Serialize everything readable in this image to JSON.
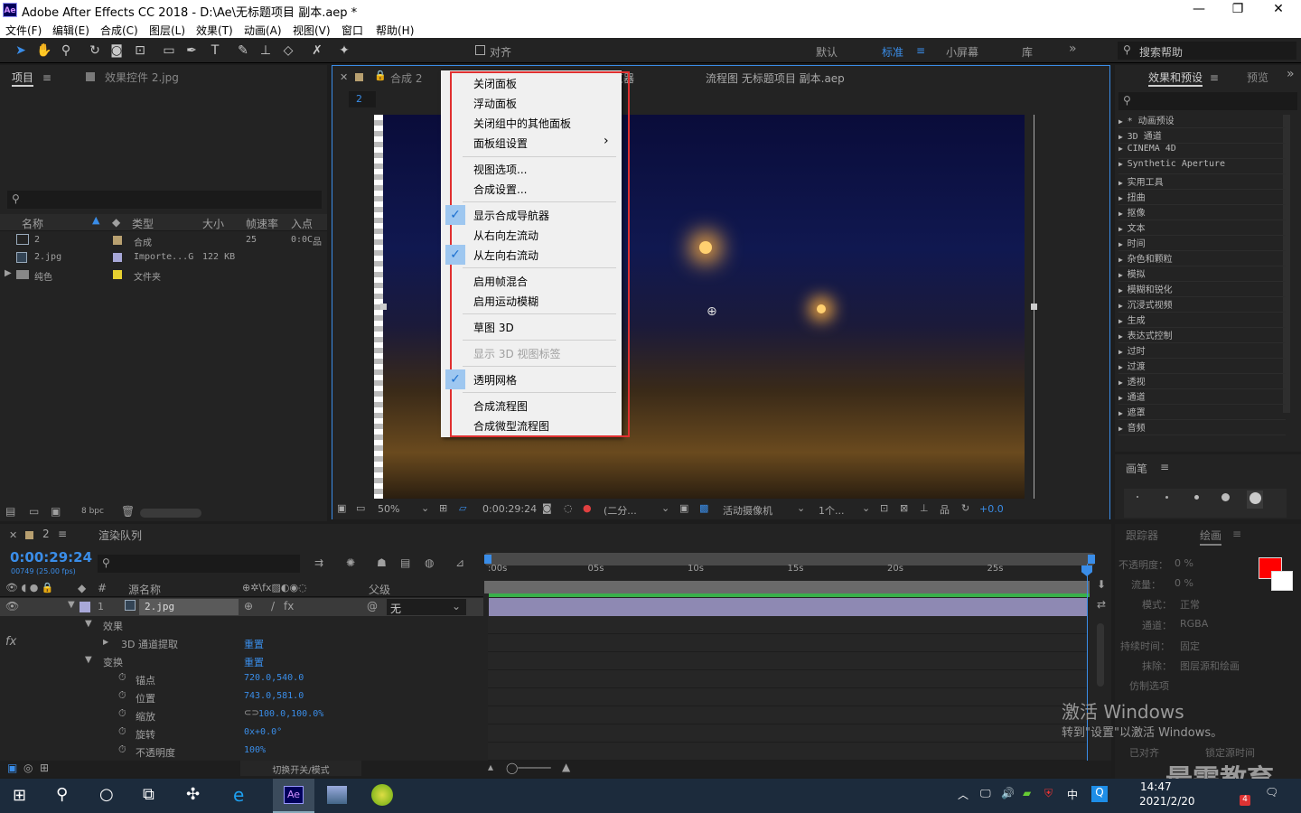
{
  "window": {
    "title": "Adobe After Effects CC 2018 - D:\\Ae\\无标题项目 副本.aep *",
    "app_badge": "Ae",
    "minimize": "—",
    "maximize": "❐",
    "close": "✕"
  },
  "menu": [
    "文件(F)",
    "编辑(E)",
    "合成(C)",
    "图层(L)",
    "效果(T)",
    "动画(A)",
    "视图(V)",
    "窗口",
    "帮助(H)"
  ],
  "toolbar": {
    "snap_label": "对齐",
    "workspaces": [
      "默认",
      "标准",
      "小屏幕",
      "库"
    ],
    "active_workspace": "标准",
    "search_placeholder": "搜索帮助",
    "more": "»"
  },
  "project_panel": {
    "tab": "项目",
    "effect_controls_tab": "效果控件 2.jpg",
    "columns": [
      "名称",
      "类型",
      "大小",
      "帧速率",
      "入点"
    ],
    "items": [
      {
        "name": "2",
        "type": "合成",
        "size": "",
        "fps": "25",
        "in": "0:0C",
        "color": "#b8a070"
      },
      {
        "name": "2.jpg",
        "type": "Importe...G",
        "size": "122 KB",
        "fps": "",
        "in": "",
        "color": "#a8a8d8"
      },
      {
        "name": "纯色",
        "type": "文件夹",
        "size": "",
        "fps": "",
        "in": "",
        "color": "#e6d030"
      }
    ],
    "bpc": "8 bpc"
  },
  "comp_panel": {
    "tab": "合成 2",
    "tab_num": "2",
    "viewer_tab": "览器",
    "flowchart_tab": "流程图 无标题项目 副本.aep",
    "zoom": "50%",
    "timecode": "0:00:29:24",
    "resolution": "(二分...",
    "camera": "活动摄像机",
    "views": "1个...",
    "exposure": "+0.0"
  },
  "context_menu": {
    "items": [
      {
        "label": "关闭面板",
        "checked": false,
        "disabled": false
      },
      {
        "label": "浮动面板",
        "checked": false,
        "disabled": false
      },
      {
        "label": "关闭组中的其他面板",
        "checked": false,
        "disabled": false
      },
      {
        "label": "面板组设置",
        "checked": false,
        "disabled": false,
        "submenu": true
      },
      {
        "label": "视图选项...",
        "checked": false,
        "disabled": false
      },
      {
        "label": "合成设置...",
        "checked": false,
        "disabled": false
      },
      {
        "label": "显示合成导航器",
        "checked": true,
        "disabled": false
      },
      {
        "label": "从右向左流动",
        "checked": false,
        "disabled": false
      },
      {
        "label": "从左向右流动",
        "checked": true,
        "disabled": false
      },
      {
        "label": "启用帧混合",
        "checked": false,
        "disabled": false
      },
      {
        "label": "启用运动模糊",
        "checked": false,
        "disabled": false
      },
      {
        "label": "草图 3D",
        "checked": false,
        "disabled": false
      },
      {
        "label": "显示 3D 视图标签",
        "checked": false,
        "disabled": true
      },
      {
        "label": "透明网格",
        "checked": true,
        "disabled": false
      },
      {
        "label": "合成流程图",
        "checked": false,
        "disabled": false
      },
      {
        "label": "合成微型流程图",
        "checked": false,
        "disabled": false
      }
    ],
    "submenu_arrow": "›",
    "check_mark": "✓"
  },
  "effects_panel": {
    "tab": "效果和预设",
    "tab2": "预览",
    "more": "»",
    "items": [
      "* 动画预设",
      "3D 通道",
      "CINEMA 4D",
      "Synthetic Aperture",
      "实用工具",
      "扭曲",
      "抠像",
      "文本",
      "时间",
      "杂色和颗粒",
      "模拟",
      "模糊和锐化",
      "沉浸式视频",
      "生成",
      "表达式控制",
      "过时",
      "过渡",
      "透视",
      "通道",
      "遮罩",
      "音频"
    ]
  },
  "paint_panel": {
    "tab": "画笔",
    "brush_sizes": [
      "1",
      "3",
      "5",
      "9",
      "13"
    ]
  },
  "paint2_panel": {
    "tracker_tab": "跟踪器",
    "paint_tab": "绘画",
    "opacity_label": "不透明度：",
    "opacity": "0 %",
    "flow_label": "流量：",
    "flow": "0 %",
    "mode_label": "模式：",
    "mode": "正常",
    "channel_label": "通道：",
    "channel": "RGBA",
    "duration_label": "持续时间：",
    "duration": "固定",
    "erase_label": "抹除：",
    "erase": "图层源和绘画",
    "clone_label": "仿制选项",
    "aligned": "已对齐",
    "lock_source": "锁定源时间"
  },
  "timeline": {
    "comp_tab": "2",
    "render_queue_tab": "渲染队列",
    "timecode": "0:00:29:24",
    "frames": "00749 (25.00 fps)",
    "source_name_header": "源名称",
    "parent_header": "父级",
    "switch_mode": "切换开关/模式",
    "ruler": [
      ":00s",
      "05s",
      "10s",
      "15s",
      "20s",
      "25s"
    ],
    "layer": {
      "num": "1",
      "name": "2.jpg",
      "parent": "无"
    },
    "rows": [
      {
        "label": "效果",
        "value": ""
      },
      {
        "label": "3D 通道提取",
        "value": "重置"
      },
      {
        "label": "变换",
        "value": "重置"
      },
      {
        "label": "锚点",
        "value": "720.0,540.0"
      },
      {
        "label": "位置",
        "value": "743.0,581.0"
      },
      {
        "label": "缩放",
        "value": "100.0,100.0%"
      },
      {
        "label": "旋转",
        "value": "0x+0.0°"
      },
      {
        "label": "不透明度",
        "value": "100%"
      }
    ]
  },
  "watermark": {
    "line1": "激活 Windows",
    "line2": "转到\"设置\"以激活 Windows。",
    "brand": "最需教育"
  },
  "taskbar": {
    "time": "14:47",
    "date": "2021/2/20",
    "ime": "中",
    "notify": "4"
  }
}
